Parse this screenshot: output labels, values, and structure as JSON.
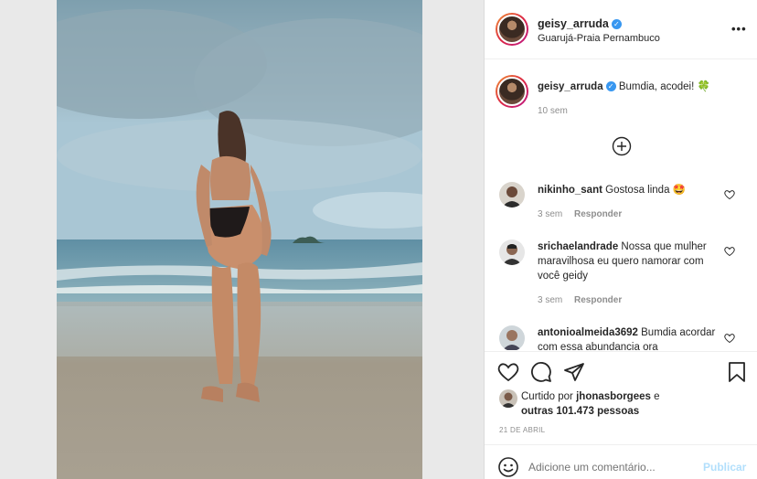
{
  "post": {
    "username": "geisy_arruda",
    "location": "Guarujá-Praia Pernambuco",
    "more_label": "•••"
  },
  "caption": {
    "username": "geisy_arruda",
    "text": "Bumdia, acodei! 🍀",
    "age": "10 sem"
  },
  "comments": [
    {
      "username": "nikinho_sant",
      "text": "Gostosa linda 🤩",
      "age": "3 sem",
      "reply": "Responder"
    },
    {
      "username": "srichaelandrade",
      "text": "Nossa que mulher maravilhosa eu quero namorar com você geidy",
      "age": "3 sem",
      "reply": "Responder"
    },
    {
      "username": "antonioalmeida3692",
      "text": "Bumdia acordar com essa abundancia ora"
    }
  ],
  "likes": {
    "prefix": "Curtido por",
    "user": "jhonasborgees",
    "and_others": "e",
    "others": "outras 101.473 pessoas"
  },
  "date": "21 DE ABRIL",
  "comment_box": {
    "placeholder": "Adicione um comentário...",
    "publish": "Publicar"
  },
  "icons": {
    "more": "more-icon",
    "load_more": "plus-circle-icon",
    "like": "heart-icon",
    "comment": "comment-icon",
    "share": "share-icon",
    "save": "bookmark-icon",
    "emoji": "emoji-icon"
  },
  "colors": {
    "verified": "#3897f0",
    "publish_disabled": "#b2dffc",
    "meta": "#8e8e8e"
  }
}
